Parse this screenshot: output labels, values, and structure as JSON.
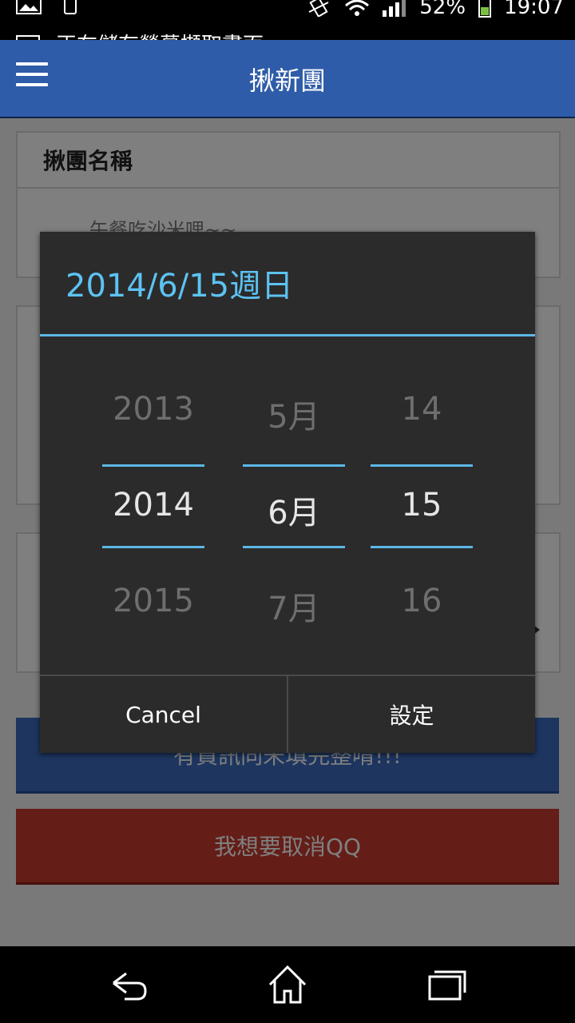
{
  "status_bar": {
    "notification": "正在儲存螢幕擷取畫面",
    "battery": "52%",
    "time": "19:07",
    "icons": [
      "gallery-icon",
      "phone-icon",
      "vibrate-icon",
      "wifi-icon",
      "signal-icon",
      "battery-icon"
    ]
  },
  "app_bar": {
    "title": "揪新團"
  },
  "form": {
    "name_label": "揪團名稱",
    "name_value": "午餐吃沙米哩~~",
    "blue_button": "有資訊同未填完整唷!!!",
    "red_button": "我想要取消QQ"
  },
  "dialog": {
    "title": "2014/6/15週日",
    "year": {
      "prev": "2013",
      "current": "2014",
      "next": "2015"
    },
    "month": {
      "prev": "5月",
      "current": "6月",
      "next": "7月"
    },
    "day": {
      "prev": "14",
      "current": "15",
      "next": "16"
    },
    "cancel": "Cancel",
    "set": "設定"
  },
  "colors": {
    "app_bar": "#2f5ca8",
    "dialog_bg": "#2b2b2b",
    "accent": "#5cc3f2",
    "cancel_btn_bg": "#c83a2e"
  }
}
